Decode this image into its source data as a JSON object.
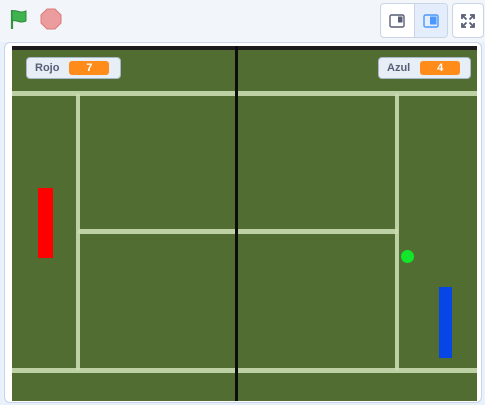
{
  "toolbar": {
    "green_flag_icon": "green-flag-icon",
    "stop_icon": "stop-sign-icon",
    "small_stage_icon": "small-stage-icon",
    "normal_stage_icon": "normal-stage-icon",
    "fullscreen_icon": "fullscreen-icon"
  },
  "stage": {
    "monitors": {
      "red": {
        "label": "Rojo",
        "value": "7"
      },
      "blue": {
        "label": "Azul",
        "value": "4"
      }
    }
  },
  "colors": {
    "grass": "#526d31",
    "court_line": "#c9dcb2",
    "net": "#0d0d0d",
    "red_paddle": "#ff0000",
    "blue_paddle": "#0645e6",
    "ball": "#12e62b",
    "monitor_value": "#ff8c1a",
    "flag": "#3fb34f",
    "stop": "#ec9c9c"
  }
}
